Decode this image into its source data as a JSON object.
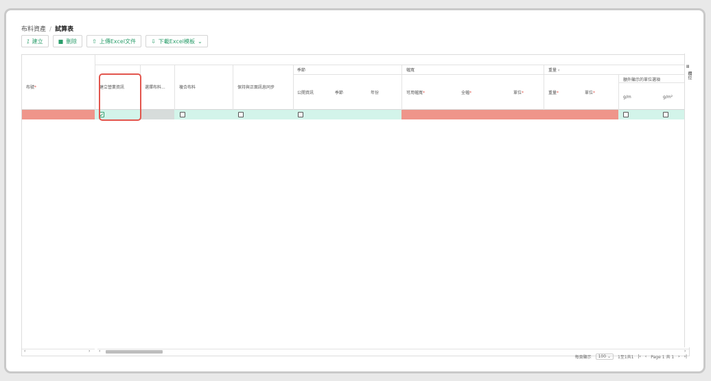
{
  "breadcrumb": {
    "root": "布料資產",
    "separator": "/",
    "current": "試算表"
  },
  "toolbar": {
    "create_label": "建立",
    "delete_label": "刪除",
    "upload_label": "上傳Excel文件",
    "download_label": "下載Excel模板"
  },
  "columns": {
    "fabric_no": "布號",
    "create_sales_info": "建立營業資訊",
    "select_fabric": "選擇布料...",
    "composite_fabric": "複合布料",
    "keep_fabric_info_sync": "保持與正面訊息同步",
    "season_group": "季節",
    "season_public": "公開資訊",
    "season": "季節",
    "year": "年份",
    "width_group": "幅寬",
    "usable_width": "可用幅寬",
    "full_width": "全幅",
    "width_unit": "單位",
    "weight_group": "重量",
    "weight": "重量",
    "weight_unit": "單位",
    "extra_units_group": "額外顯示的單位選項",
    "unit_gm": "g/m",
    "unit_gm2": "g/m²"
  },
  "side_panel": {
    "label": "欄位"
  },
  "footer": {
    "per_page_label": "每頁顯示",
    "per_page_value": "100",
    "range_text": "1至1共1",
    "page_text": "Page 1 共 1"
  },
  "row": {
    "create_sales_info_checked": true
  },
  "colors": {
    "accent": "#2a9d6a",
    "required_row": "#ef958a",
    "editable_row": "#d3f4ea",
    "highlight": "#e2544c"
  }
}
